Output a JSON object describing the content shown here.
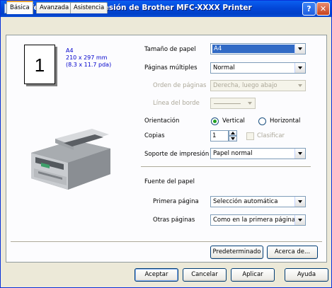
{
  "window": {
    "title": "Preferencias de impresión de Brother MFC-XXXX Printer",
    "help_glyph": "?",
    "close_glyph": "✕"
  },
  "tabs": [
    {
      "label": "Básica",
      "active": true
    },
    {
      "label": "Avanzada"
    },
    {
      "label": "Asistencia"
    }
  ],
  "preview": {
    "page_number": "1",
    "paper_name": "A4",
    "paper_mm": "210 x 297 mm",
    "paper_in": "(8.3 x 11.7 pda)"
  },
  "form": {
    "paper_size": {
      "label": "Tamaño de papel",
      "value": "A4"
    },
    "multiple_pages": {
      "label": "Páginas múltiples",
      "value": "Normal"
    },
    "page_order": {
      "label": "Orden de páginas",
      "value": "Derecha, luego abajo"
    },
    "border_line": {
      "label": "Línea del borde",
      "value": ""
    },
    "orientation": {
      "label": "Orientación",
      "options": [
        "Vertical",
        "Horizontal"
      ],
      "selected": "Vertical"
    },
    "copies": {
      "label": "Copias",
      "value": "1",
      "collate_label": "Clasificar"
    },
    "media": {
      "label": "Soporte de impresión",
      "value": "Papel normal"
    },
    "paper_source": {
      "label": "Fuente del papel",
      "first_page": {
        "label": "Primera página",
        "value": "Selección automática"
      },
      "other_pages": {
        "label": "Otras páginas",
        "value": "Como en la primera página"
      }
    }
  },
  "panel_buttons": {
    "default": "Predeterminado",
    "about": "Acerca de..."
  },
  "dialog_buttons": {
    "ok": "Aceptar",
    "cancel": "Cancelar",
    "apply": "Aplicar",
    "help": "Ayuda"
  },
  "colors": {
    "titlebar": "#0347d8",
    "selection": "#316ac5",
    "dialog_bg": "#ece9d8",
    "link_text": "#0000cc"
  }
}
